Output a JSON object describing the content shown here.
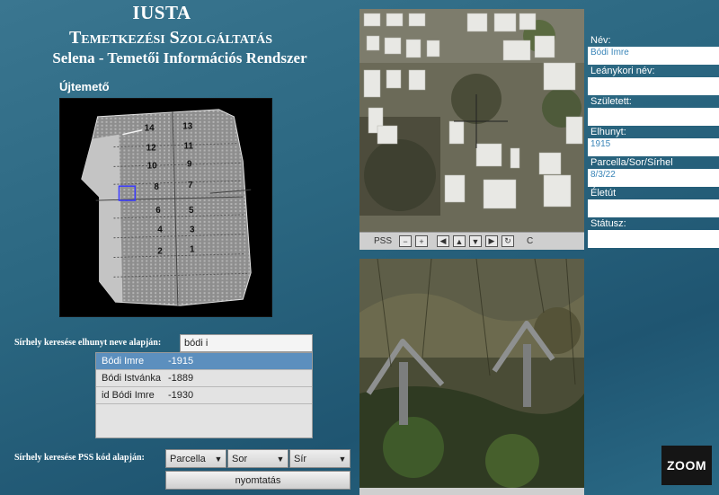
{
  "header": {
    "title1": "IUSTA",
    "title2": "Temetkezési Szolgáltatás",
    "title3": "Selena - Temetői Információs Rendszer"
  },
  "cemetery_name": "Újtemető",
  "map": {
    "parcels": [
      "14",
      "13",
      "12",
      "11",
      "10",
      "9",
      "8",
      "7",
      "6",
      "5",
      "4",
      "3",
      "2",
      "1"
    ]
  },
  "name_search": {
    "label": "Sírhely keresése elhunyt neve alapján:",
    "value": "bódi i",
    "results": [
      {
        "name": "Bódi Imre",
        "year": "-1915"
      },
      {
        "name": "Bódi Istvánka",
        "year": "-1889"
      },
      {
        "name": "id Bódi Imre",
        "year": "-1930"
      }
    ]
  },
  "pss_search": {
    "label": "Sírhely keresése  PSS kód alapján:",
    "parcel": "Parcella",
    "row": "Sor",
    "grave": "Sír",
    "print_label": "nyomtatás"
  },
  "aerial_toolbar": {
    "pss_label": "PSS",
    "c_label": "C"
  },
  "info": {
    "name_label": "Név:",
    "name_value": "Bódi Imre",
    "maiden_label": "Leánykori név:",
    "maiden_value": "",
    "born_label": "Született:",
    "born_value": "",
    "died_label": "Elhunyt:",
    "died_value": "1915",
    "pss_label": "Parcella/Sor/Sírhel",
    "pss_value": "8/3/22",
    "life_label": "Életút",
    "life_value": "",
    "status_label": "Státusz:",
    "status_value": ""
  },
  "zoom_logo": "ZOOM"
}
